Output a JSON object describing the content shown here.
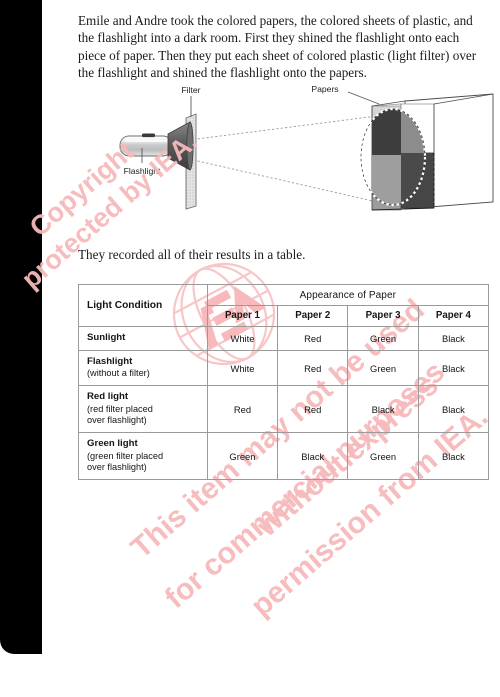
{
  "document": {
    "intro_paragraph": "Emile and Andre took the colored papers, the colored sheets of plastic, and the flashlight into a dark room. First they shined the flashlight onto each piece of paper. Then they put each sheet of colored plastic (light filter) over the flashlight and shined the flashlight onto the papers.",
    "results_sentence": "They recorded all of their results in a table."
  },
  "diagram": {
    "labels": {
      "filter": "Filter",
      "flashlight": "Flashlight",
      "papers": "Papers"
    }
  },
  "table": {
    "header": {
      "condition": "Light Condition",
      "appearance": "Appearance of Paper",
      "papers": [
        "Paper 1",
        "Paper 2",
        "Paper 3",
        "Paper 4"
      ]
    },
    "rows": [
      {
        "title": "Sunlight",
        "sub": "",
        "values": [
          "White",
          "Red",
          "Green",
          "Black"
        ]
      },
      {
        "title": "Flashlight",
        "sub": "(without a filter)",
        "values": [
          "White",
          "Red",
          "Green",
          "Black"
        ]
      },
      {
        "title": "Red light",
        "sub": "(red filter placed\nover flashlight)",
        "values": [
          "Red",
          "Red",
          "Black",
          "Black"
        ]
      },
      {
        "title": "Green light",
        "sub": "(green filter placed\nover flashlight)",
        "values": [
          "Green",
          "Black",
          "Green",
          "Black"
        ]
      }
    ]
  },
  "watermark": {
    "copyright_line1": "Copyright",
    "copyright_line2": "protected by IEA.",
    "notice_line1": "This item may not be used",
    "notice_line2": "for commercial purposes",
    "notice_line3": "without express",
    "notice_line4": "permission from IEA.",
    "logo_text": "IEA",
    "color": "#f7b9bb"
  },
  "colors": {
    "binding": "#000000",
    "page_background": "#ffffff",
    "text": "#1b1b1b",
    "table_border": "#9a9a9a"
  }
}
